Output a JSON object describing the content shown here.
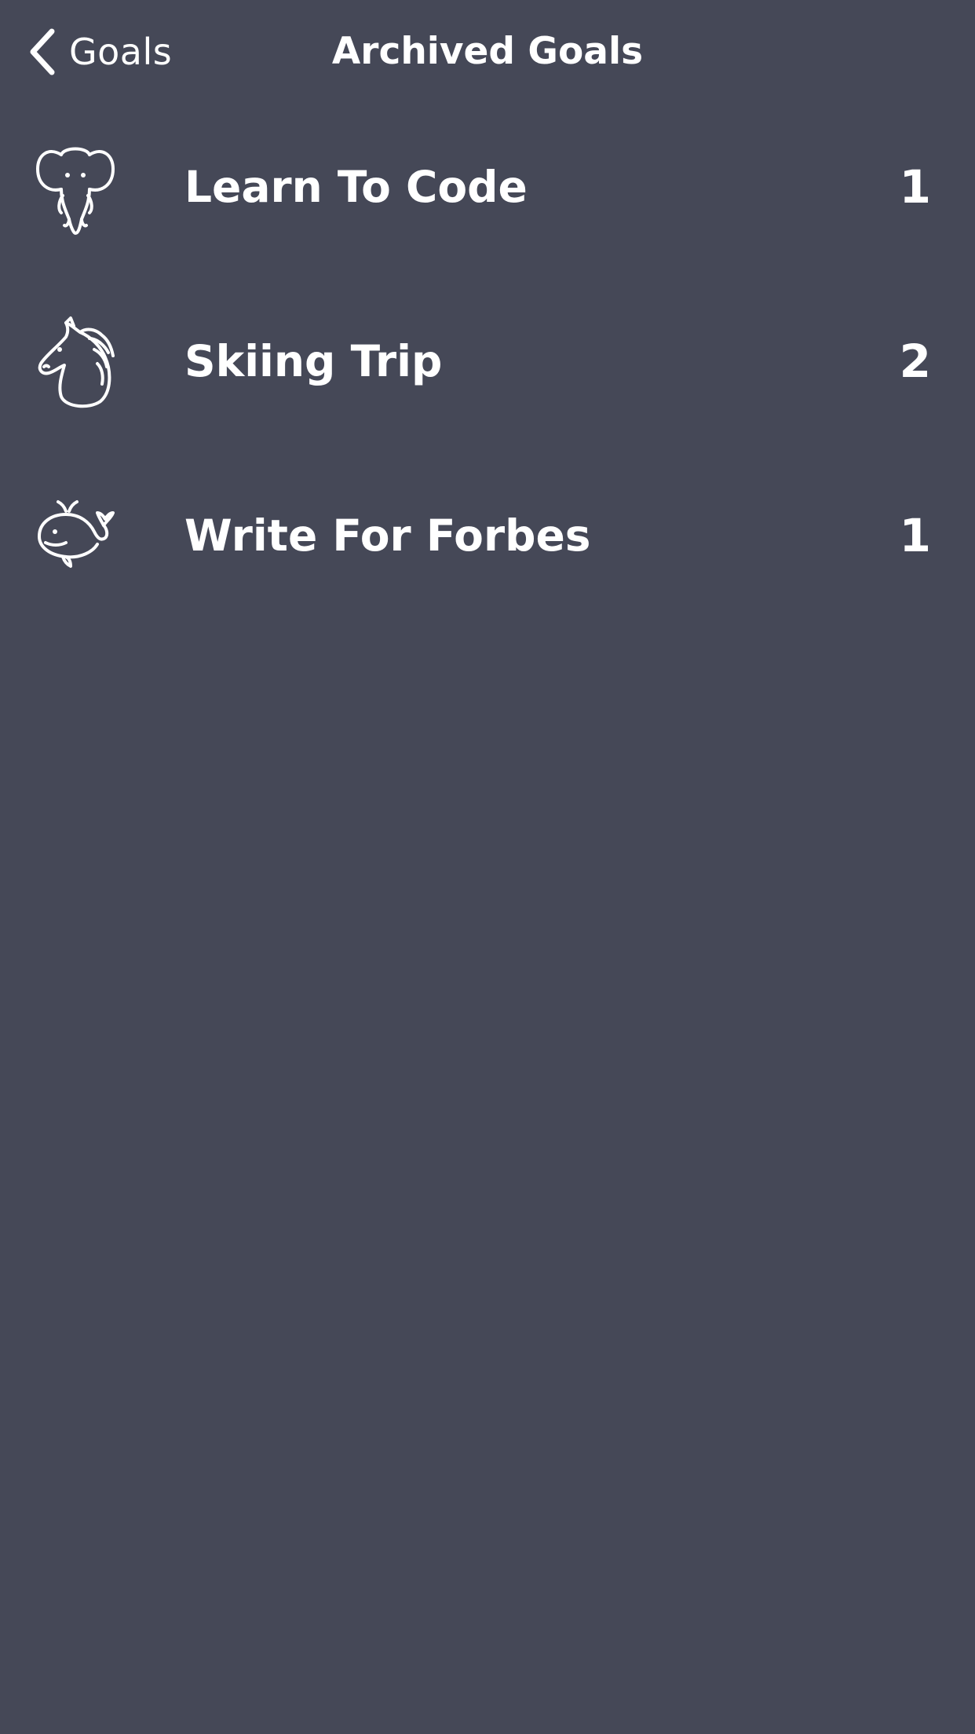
{
  "nav": {
    "back_label": "Goals",
    "title": "Archived Goals"
  },
  "colors": {
    "background": "#454857",
    "text": "#ffffff"
  },
  "goals": [
    {
      "icon": "elephant-icon",
      "name": "Learn To Code",
      "count": "1"
    },
    {
      "icon": "horse-icon",
      "name": "Skiing Trip",
      "count": "2"
    },
    {
      "icon": "whale-icon",
      "name": "Write For Forbes",
      "count": "1"
    }
  ]
}
